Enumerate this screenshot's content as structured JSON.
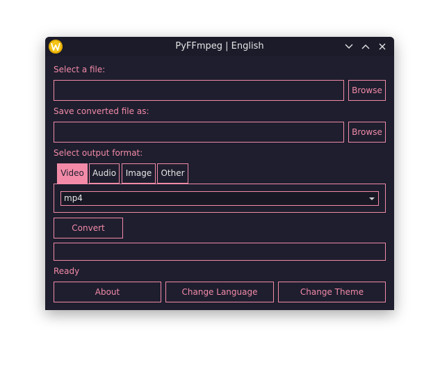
{
  "window": {
    "title": "PyFFmpeg | English",
    "controls": {
      "minimize": "chevron-down",
      "maximize": "chevron-up",
      "close": "close-x"
    }
  },
  "file": {
    "label": "Select a file:",
    "value": "",
    "browse_label": "Browse"
  },
  "save": {
    "label": "Save converted file as:",
    "value": "",
    "browse_label": "Browse"
  },
  "format": {
    "label": "Select output format:",
    "tabs": [
      {
        "label": "Video",
        "active": true
      },
      {
        "label": "Audio",
        "active": false
      },
      {
        "label": "Image",
        "active": false
      },
      {
        "label": "Other",
        "active": false
      }
    ],
    "selected": "mp4"
  },
  "convert_label": "Convert",
  "progress_value": 0,
  "status": "Ready",
  "buttons": {
    "about": "About",
    "change_language": "Change Language",
    "change_theme": "Change Theme"
  },
  "colors": {
    "accent": "#f38ba8",
    "background": "#1e1e2e",
    "title_bar": "#1b1b2a",
    "text": "#e6e6e6"
  }
}
